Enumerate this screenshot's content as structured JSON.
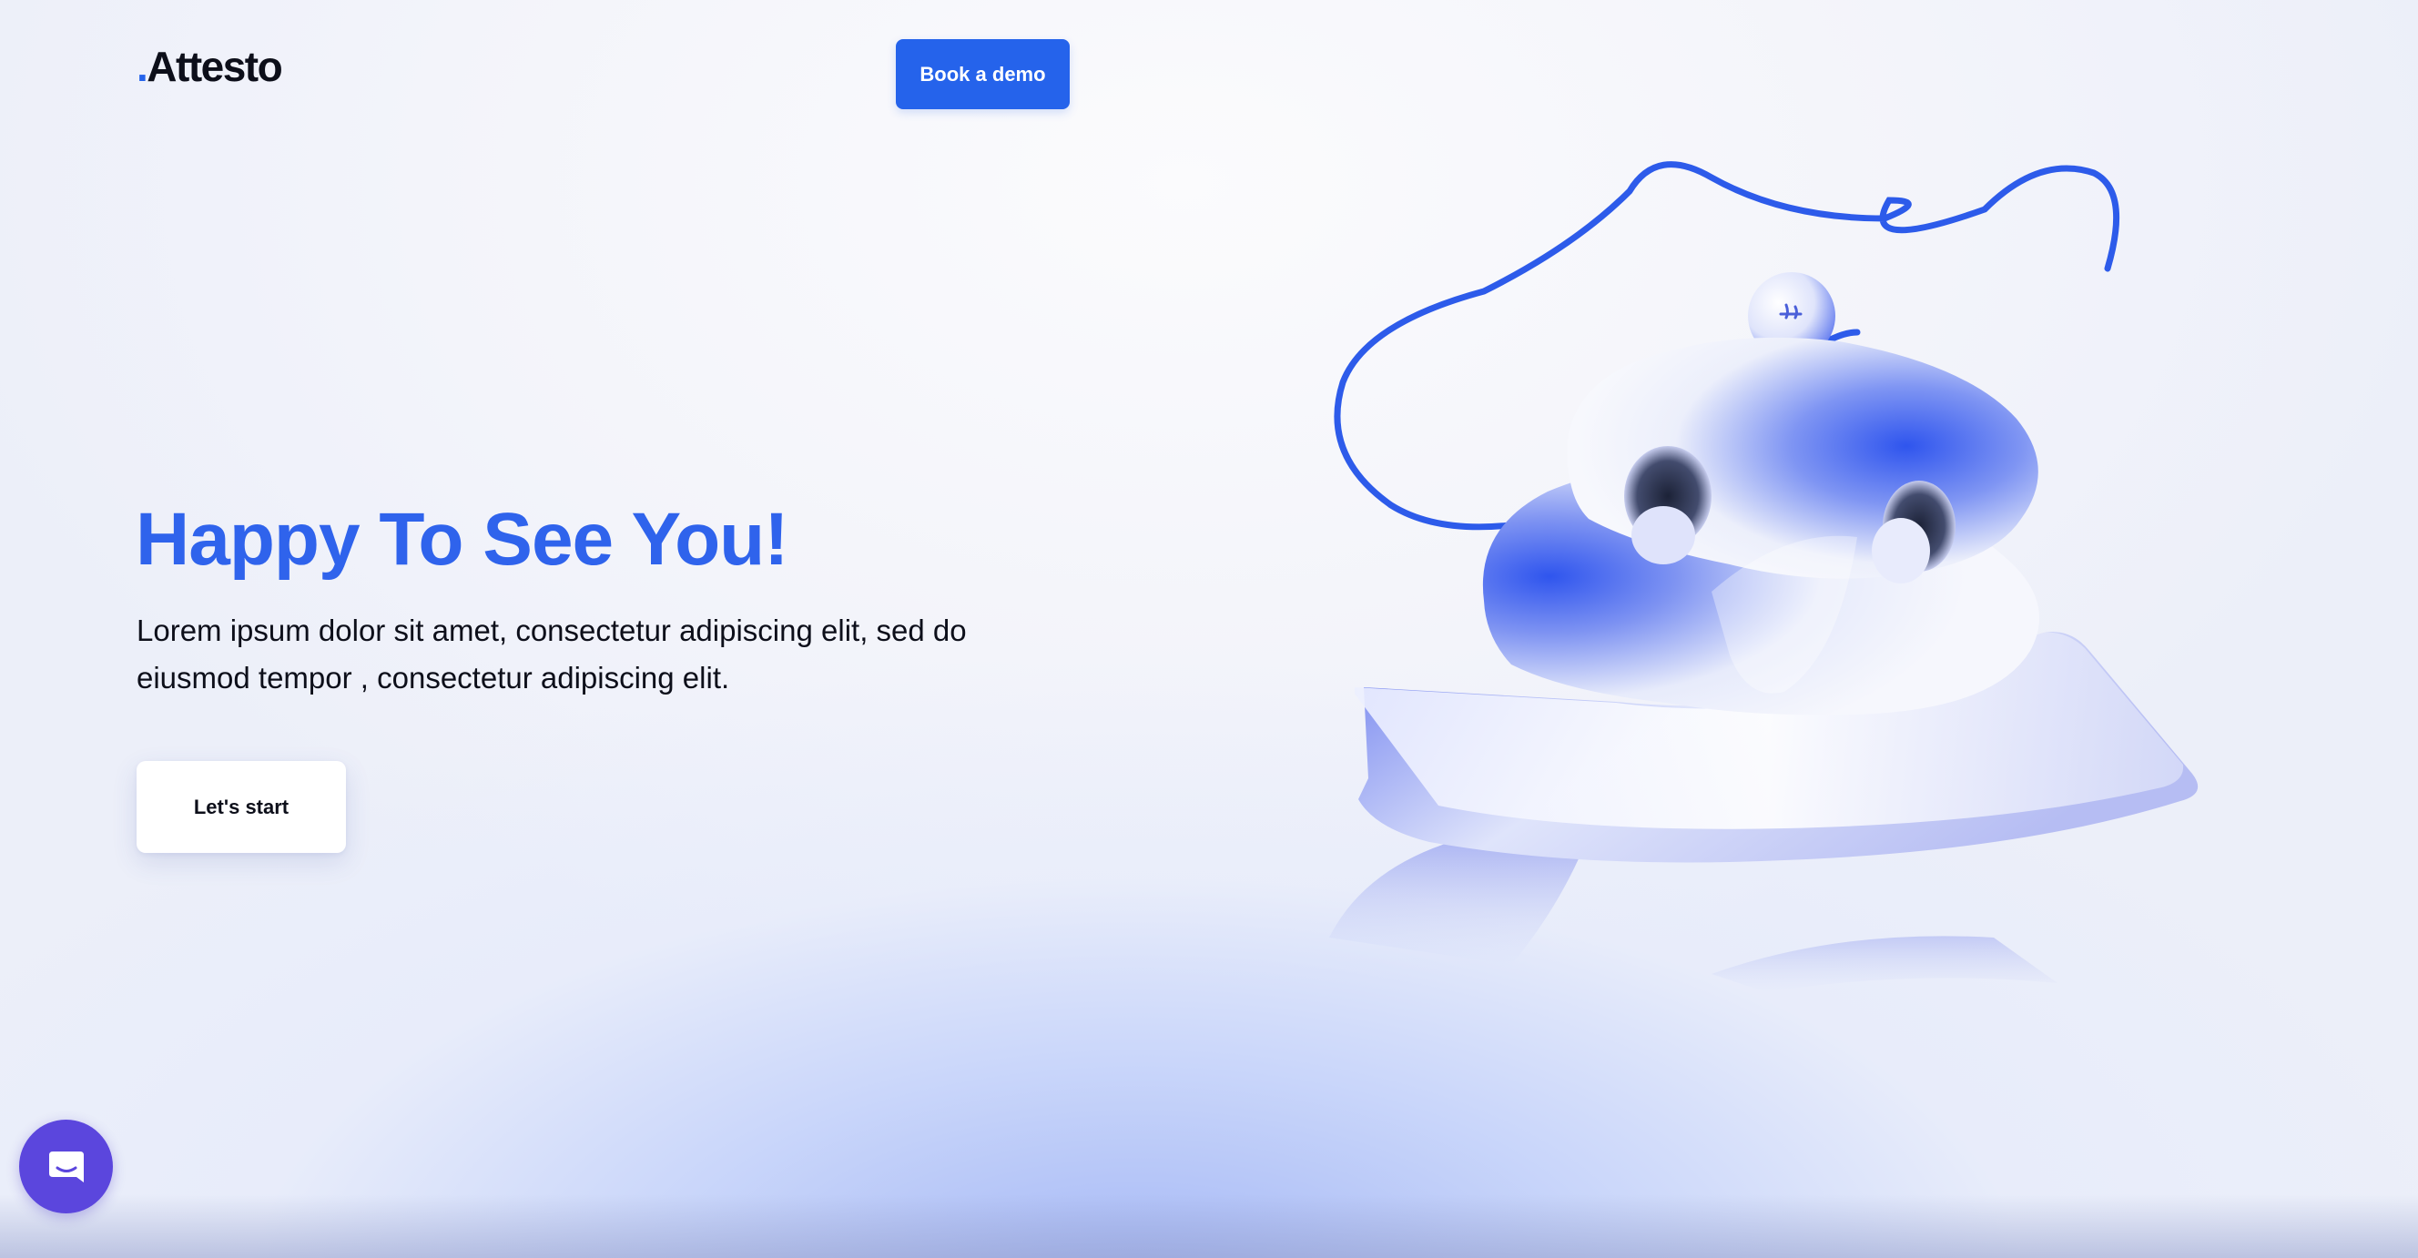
{
  "header": {
    "logo_dot": ".",
    "logo_text": "Attesto",
    "demo_button_label": "Book a demo"
  },
  "hero": {
    "title": "Happy To See You!",
    "description": "Lorem ipsum dolor sit amet, consectetur adipiscing elit, sed do eiusmod tempor , consectetur adipiscing elit.",
    "start_button_label": "Let's start",
    "illustration_icon": "abstract-3d-knot-illustration"
  },
  "chat_widget": {
    "icon": "chat-bubble-icon"
  },
  "colors": {
    "accent": "#2563eb",
    "title": "#2f63ec",
    "text": "#0d0f1a",
    "chat": "#5b46dd"
  }
}
